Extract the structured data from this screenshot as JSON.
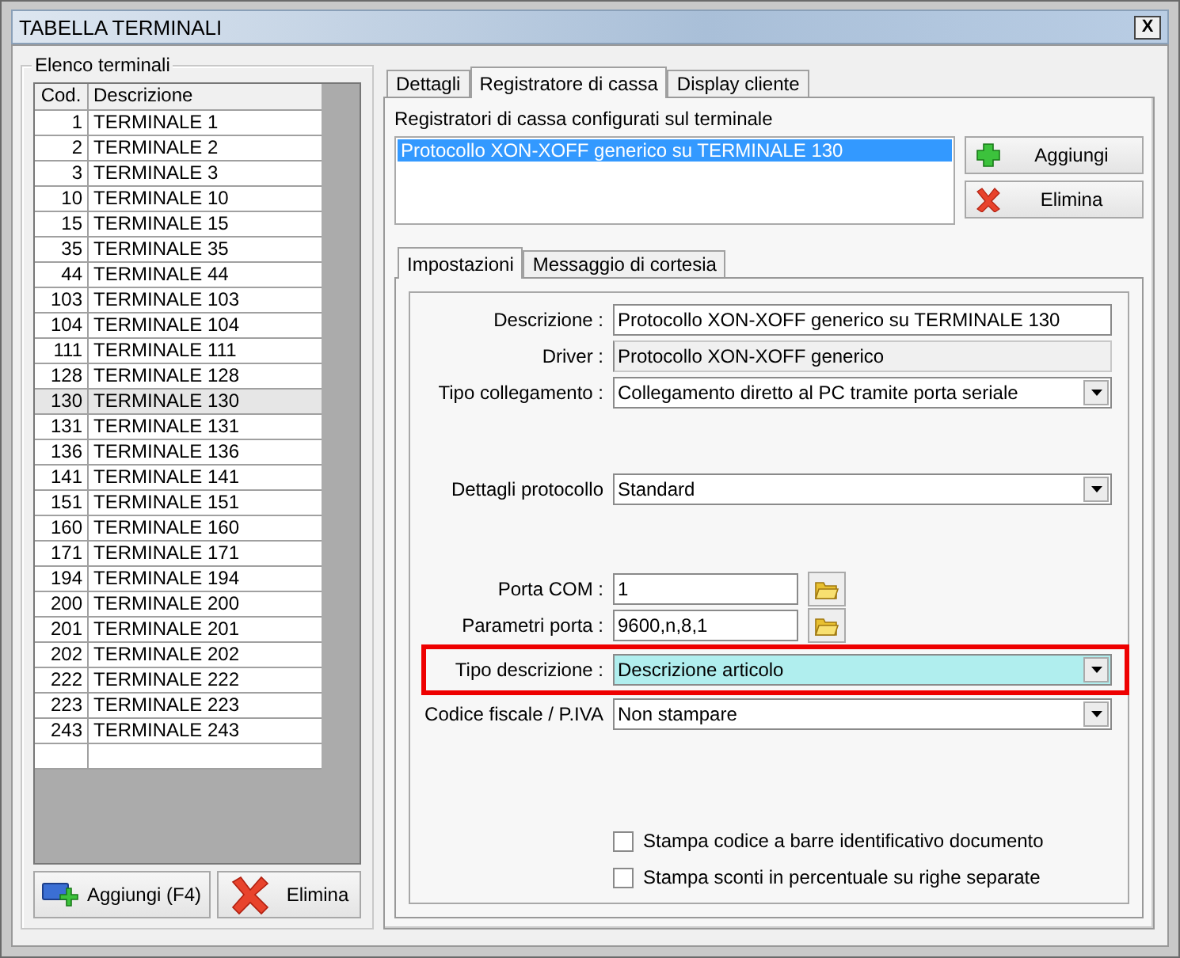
{
  "window": {
    "title": "TABELLA TERMINALI",
    "close": "X"
  },
  "terminal_list": {
    "legend": "Elenco terminali",
    "columns": [
      "Cod.",
      "Descrizione"
    ],
    "rows": [
      {
        "code": "1",
        "description": "TERMINALE 1",
        "selected": false
      },
      {
        "code": "2",
        "description": "TERMINALE 2",
        "selected": false
      },
      {
        "code": "3",
        "description": "TERMINALE 3",
        "selected": false
      },
      {
        "code": "10",
        "description": "TERMINALE 10",
        "selected": false
      },
      {
        "code": "15",
        "description": "TERMINALE 15",
        "selected": false
      },
      {
        "code": "35",
        "description": "TERMINALE 35",
        "selected": false
      },
      {
        "code": "44",
        "description": "TERMINALE 44",
        "selected": false
      },
      {
        "code": "103",
        "description": "TERMINALE 103",
        "selected": false
      },
      {
        "code": "104",
        "description": "TERMINALE 104",
        "selected": false
      },
      {
        "code": "111",
        "description": "TERMINALE 111",
        "selected": false
      },
      {
        "code": "128",
        "description": "TERMINALE 128",
        "selected": false
      },
      {
        "code": "130",
        "description": "TERMINALE 130",
        "selected": true
      },
      {
        "code": "131",
        "description": "TERMINALE 131",
        "selected": false
      },
      {
        "code": "136",
        "description": "TERMINALE 136",
        "selected": false
      },
      {
        "code": "141",
        "description": "TERMINALE 141",
        "selected": false
      },
      {
        "code": "151",
        "description": "TERMINALE 151",
        "selected": false
      },
      {
        "code": "160",
        "description": "TERMINALE 160",
        "selected": false
      },
      {
        "code": "171",
        "description": "TERMINALE 171",
        "selected": false
      },
      {
        "code": "194",
        "description": "TERMINALE 194",
        "selected": false
      },
      {
        "code": "200",
        "description": "TERMINALE 200",
        "selected": false
      },
      {
        "code": "201",
        "description": "TERMINALE 201",
        "selected": false
      },
      {
        "code": "202",
        "description": "TERMINALE 202",
        "selected": false
      },
      {
        "code": "222",
        "description": "TERMINALE 222",
        "selected": false
      },
      {
        "code": "223",
        "description": "TERMINALE 223",
        "selected": false
      },
      {
        "code": "243",
        "description": "TERMINALE 243",
        "selected": false
      }
    ],
    "buttons": [
      {
        "label": "Aggiungi (F4)",
        "kind": "add"
      },
      {
        "label": "Elimina",
        "kind": "delete"
      }
    ]
  },
  "tabs": [
    {
      "label": "Dettagli",
      "selected": false
    },
    {
      "label": "Registratore di cassa",
      "selected": true
    },
    {
      "label": "Display cliente",
      "selected": false
    }
  ],
  "registers": {
    "label": "Registratori di cassa configurati sul terminale",
    "items": [
      {
        "label": "Protocollo XON-XOFF generico su TERMINALE 130",
        "selected": true
      }
    ],
    "buttons": [
      {
        "label": "Aggiungi",
        "kind": "add"
      },
      {
        "label": "Elimina",
        "kind": "delete"
      }
    ]
  },
  "sub_tabs": [
    {
      "label": "Impostazioni",
      "selected": true
    },
    {
      "label": "Messaggio di cortesia",
      "selected": false
    }
  ],
  "fields": [
    {
      "label": "Descrizione :",
      "value": "Protocollo XON-XOFF generico su TERMINALE 130",
      "kind": "text",
      "highlighted": false
    },
    {
      "label": "Driver :",
      "value": "Protocollo XON-XOFF generico",
      "kind": "readonly",
      "highlighted": false
    },
    {
      "label": "Tipo collegamento :",
      "value": "Collegamento diretto al PC tramite porta seriale",
      "kind": "dropdown",
      "highlighted": false
    },
    {
      "label": "Dettagli protocollo",
      "value": "Standard",
      "kind": "dropdown",
      "highlighted": false
    },
    {
      "label": "Porta COM :",
      "value": "1",
      "kind": "browse",
      "highlighted": false
    },
    {
      "label": "Parametri porta :",
      "value": "9600,n,8,1",
      "kind": "browse",
      "highlighted": false
    },
    {
      "label": "Tipo descrizione :",
      "value": "Descrizione articolo",
      "kind": "dropdown",
      "highlighted": true
    },
    {
      "label": "Codice fiscale / P.IVA",
      "value": "Non stampare",
      "kind": "dropdown",
      "highlighted": false
    }
  ],
  "options": [
    {
      "label": "Stampa codice a barre identificativo documento",
      "checked": false
    },
    {
      "label": "Stampa sconti in percentuale su righe separate",
      "checked": false
    }
  ]
}
